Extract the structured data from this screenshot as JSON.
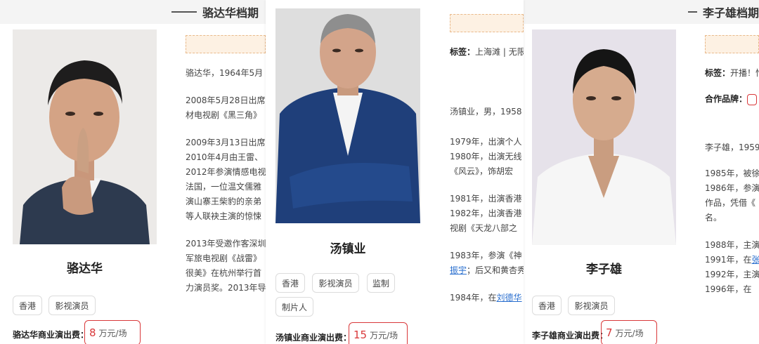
{
  "left": {
    "header_title": "骆达华档期",
    "name": "骆达华",
    "tags": [
      "香港",
      "影视演员"
    ],
    "fee_label": "骆达华商业演出费：",
    "fee_value": "8",
    "fee_unit": "万元/场",
    "bio_lines": [
      [
        "骆达华，1964年5月"
      ],
      [
        "2008年5月28日出席",
        "材电视剧《黑三角》"
      ],
      [
        "2009年3月13日出席",
        "2010年4月由王雷、",
        "2012年参演情感电视",
        "法国，一位温文儒雅",
        "演山寨王柴豹的亲弟",
        "等人联袂主演的惊悚"
      ],
      [
        "2013年受邀作客深圳",
        "军旅电视剧《战雷》",
        "很美》在杭州举行首",
        "力演员奖。2013年导"
      ]
    ]
  },
  "mid": {
    "name": "汤镇业",
    "tags": [
      "香港",
      "影视演员",
      "监制",
      "制片人"
    ],
    "fee_label": "汤镇业商业演出费：",
    "fee_value": "15",
    "fee_unit": "万元/场",
    "label_prefix": "标签：",
    "label_text": "上海滩 | 无限",
    "bio_intro": "汤镇业，男，1958",
    "bio_lines": [
      [
        "1979年，出演个人",
        "1980年，出演无线",
        "《风云》，饰胡宏",
        "1981年，出演香港",
        "1982年，出演香港",
        "视剧《天龙八部之"
      ]
    ],
    "p1983_a": "1983年，参演《神",
    "p1983_link": "振宇",
    "p1983_b": "；后又和黄杏秀",
    "p1984_a": "1984年，在",
    "p1984_link": "刘德华"
  },
  "right": {
    "header_title": "李子雄档期",
    "name": "李子雄",
    "tags": [
      "香港",
      "影视演员"
    ],
    "fee_label": "李子雄商业演出费：",
    "fee_value": "7",
    "fee_unit": "万元/场",
    "label_prefix": "标签：",
    "label_text": "开播！恰",
    "brand_label": "合作品牌：",
    "bio_intro": "李子雄，1959",
    "bio_a": [
      "1985年，被徐",
      "1986年，参演",
      "作品，凭借《",
      "名。"
    ],
    "bio_b": [
      "1988年，主演",
      "1991年，在",
      "1992年，主演",
      "1996年，在"
    ],
    "bio_b_link": "张"
  },
  "colors": {
    "accent_red": "#d9383a",
    "orange_box": "#fdf1e3",
    "link": "#2a6fcf"
  }
}
